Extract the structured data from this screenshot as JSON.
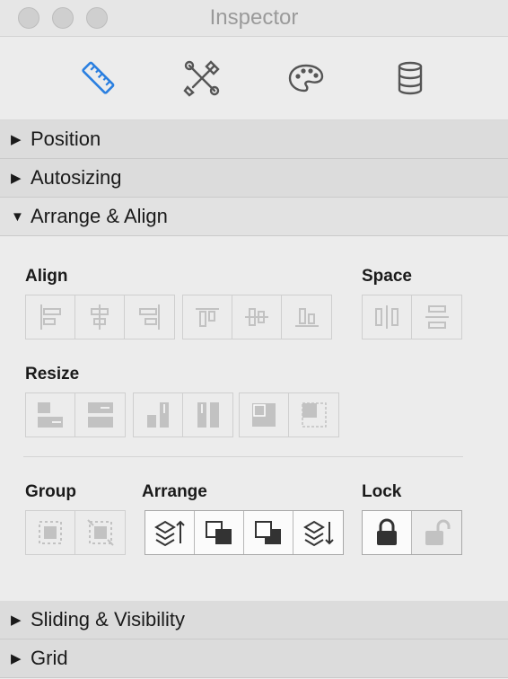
{
  "window": {
    "title": "Inspector"
  },
  "tabs": [
    {
      "icon": "ruler-icon"
    },
    {
      "icon": "tools-icon"
    },
    {
      "icon": "palette-icon"
    },
    {
      "icon": "database-icon"
    }
  ],
  "sections": {
    "position": "Position",
    "autosizing": "Autosizing",
    "arrange_align": "Arrange & Align",
    "sliding_visibility": "Sliding & Visibility",
    "grid": "Grid"
  },
  "arrange_align": {
    "align_label": "Align",
    "space_label": "Space",
    "resize_label": "Resize",
    "group_label": "Group",
    "arrange_label": "Arrange",
    "lock_label": "Lock"
  },
  "colors": {
    "accent": "#2a7fe0",
    "disabled_icon": "#c2c2c2",
    "active_icon": "#333333"
  }
}
